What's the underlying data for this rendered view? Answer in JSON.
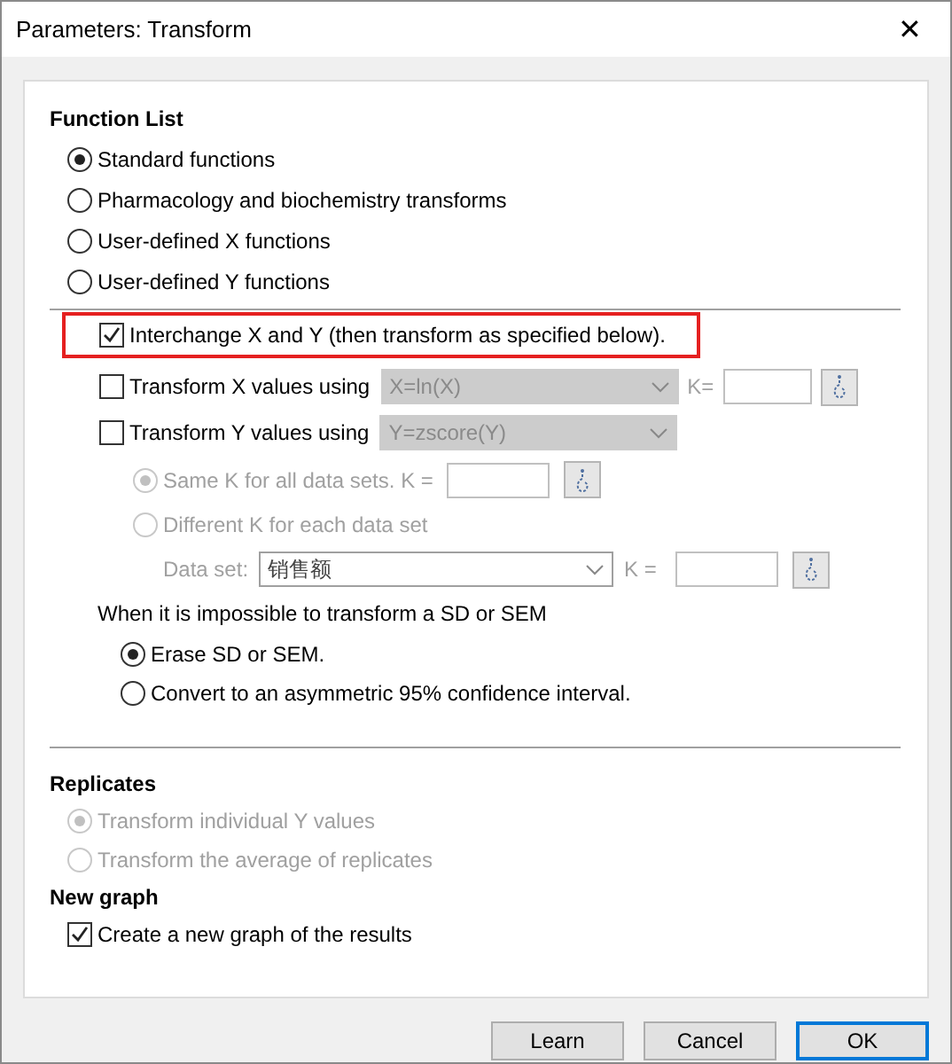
{
  "window": {
    "title": "Parameters: Transform",
    "close_glyph": "✕"
  },
  "function_list": {
    "heading": "Function List",
    "options": [
      {
        "label": "Standard functions",
        "selected": true
      },
      {
        "label": "Pharmacology and biochemistry transforms",
        "selected": false
      },
      {
        "label": "User-defined X functions",
        "selected": false
      },
      {
        "label": "User-defined Y functions",
        "selected": false
      }
    ]
  },
  "interchange": {
    "label": "Interchange X and Y (then transform as specified below).",
    "checked": true,
    "highlighted": true
  },
  "transforms": [
    {
      "label": "Transform X values using",
      "checked": false,
      "function": "X=ln(X)",
      "k_label": "K="
    },
    {
      "label": "Transform Y values using",
      "checked": false,
      "function": "Y=zscore(Y)"
    }
  ],
  "k_options": {
    "disabled": true,
    "options": [
      {
        "label": "Same K for all data sets. K =",
        "selected": true
      },
      {
        "label": "Different K for each data set",
        "selected": false
      }
    ]
  },
  "data_set": {
    "label": "Data set:",
    "value": "销售额",
    "k_label": "K ="
  },
  "sd_section": {
    "text": "When it is impossible to transform a SD or SEM",
    "options": [
      {
        "label": "Erase SD or SEM.",
        "selected": true
      },
      {
        "label": "Convert to an asymmetric 95% confidence interval.",
        "selected": false
      }
    ]
  },
  "replicates": {
    "heading": "Replicates",
    "disabled": true,
    "options": [
      {
        "label": "Transform individual Y values",
        "selected": true
      },
      {
        "label": "Transform the average of replicates",
        "selected": false
      }
    ]
  },
  "new_graph": {
    "heading": "New graph",
    "label": "Create a new graph of the results",
    "checked": true
  },
  "buttons": [
    {
      "label": "Learn",
      "default": false
    },
    {
      "label": "Cancel",
      "default": false
    },
    {
      "label": "OK",
      "default": true
    }
  ]
}
